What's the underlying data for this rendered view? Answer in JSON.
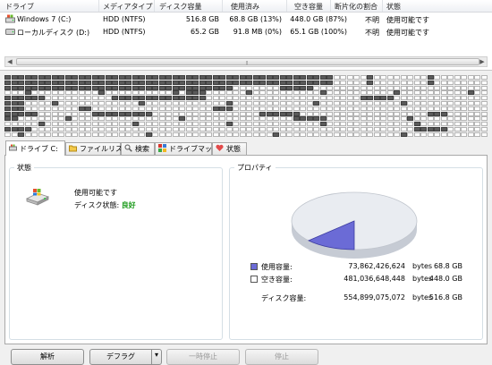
{
  "drive_list": {
    "columns": [
      "ドライブ",
      "メディアタイプ",
      "ディスク容量",
      "使用済み",
      "空き容量",
      "断片化の割合",
      "状態"
    ],
    "rows": [
      {
        "name": "Windows 7 (C:)",
        "media": "HDD (NTFS)",
        "capacity": "516.8 GB",
        "used": "68.8 GB (13%)",
        "free": "448.0 GB (87%)",
        "frag": "不明",
        "status": "使用可能です"
      },
      {
        "name": "ローカルディスク (D:)",
        "media": "HDD (NTFS)",
        "capacity": "65.2 GB",
        "used": "91.8 MB (0%)",
        "free": "65.1 GB (100%)",
        "frag": "不明",
        "status": "使用可能です"
      }
    ]
  },
  "scrollbar": {
    "grip": "⦙⦙⦙"
  },
  "block_map": {
    "columns": 72,
    "rows": 12,
    "used_ratio_note": "mostly free with used segments"
  },
  "tabs": [
    {
      "label": "ドライブ C:",
      "icon": "drive-icon",
      "active": true
    },
    {
      "label": "ファイルリスト",
      "icon": "folder-icon",
      "active": false
    },
    {
      "label": "検索",
      "icon": "search-icon",
      "active": false
    },
    {
      "label": "ドライブマップ",
      "icon": "drive-map-icon",
      "active": false
    },
    {
      "label": "状態",
      "icon": "status-icon",
      "active": false
    }
  ],
  "status_group": {
    "legend": "状態",
    "line1": "使用可能です",
    "line2_label": "ディスク状態:",
    "line2_value": "良好",
    "value_color": "#1a9a1a"
  },
  "properties_group": {
    "legend": "プロパティ",
    "used_label": "使用容量:",
    "used_bytes": "73,862,426,624",
    "used_unit": "bytes",
    "used_size": "68.8 GB",
    "used_color": "#6b6bd6",
    "free_label": "空き容量:",
    "free_bytes": "481,036,648,448",
    "free_unit": "bytes",
    "free_size": "448.0 GB",
    "free_color": "#ffffff",
    "total_label": "ディスク容量:",
    "total_bytes": "554,899,075,072",
    "total_unit": "bytes",
    "total_size": "516.8 GB",
    "used_fraction": 0.13
  },
  "buttons": {
    "analyze": "解析",
    "defrag": "デフラグ",
    "pause": "一時停止",
    "stop": "停止"
  }
}
